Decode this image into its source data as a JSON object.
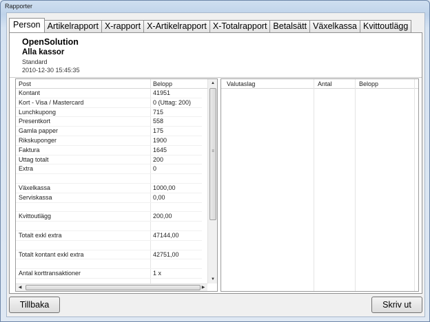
{
  "window": {
    "title": "Rapporter"
  },
  "tabs": [
    {
      "label": "Person",
      "active": true
    },
    {
      "label": "Artikelrapport"
    },
    {
      "label": "X-rapport"
    },
    {
      "label": "X-Artikelrapport"
    },
    {
      "label": "X-Totalrapport"
    },
    {
      "label": "Betalsätt"
    },
    {
      "label": "Växelkassa"
    },
    {
      "label": "Kvittoutlägg"
    }
  ],
  "header": {
    "company": "OpenSolution",
    "scope": "Alla kassor",
    "mode": "Standard",
    "datetime": "2010-12-30 15:45:35"
  },
  "left_table": {
    "columns": [
      "Post",
      "Belopp"
    ],
    "rows": [
      {
        "post": "Kontant",
        "belopp": "41951"
      },
      {
        "post": "Kort - Visa / Mastercard",
        "belopp": "0 (Uttag: 200)"
      },
      {
        "post": "Lunchkupong",
        "belopp": "715"
      },
      {
        "post": "Presentkort",
        "belopp": "558"
      },
      {
        "post": "Gamla papper",
        "belopp": "175"
      },
      {
        "post": "Rikskuponger",
        "belopp": "1900"
      },
      {
        "post": "Faktura",
        "belopp": "1645"
      },
      {
        "post": "Uttag totalt",
        "belopp": "200"
      },
      {
        "post": "Extra",
        "belopp": "0"
      },
      {
        "post": "",
        "belopp": ""
      },
      {
        "post": "Växelkassa",
        "belopp": "1000,00"
      },
      {
        "post": "Serviskassa",
        "belopp": "0,00"
      },
      {
        "post": "",
        "belopp": ""
      },
      {
        "post": "Kvittoutlägg",
        "belopp": "200,00"
      },
      {
        "post": "",
        "belopp": ""
      },
      {
        "post": "Totalt exkl extra",
        "belopp": "47144,00"
      },
      {
        "post": "",
        "belopp": ""
      },
      {
        "post": "Totalt kontant exkl extra",
        "belopp": "42751,00"
      },
      {
        "post": "",
        "belopp": ""
      },
      {
        "post": "Antal korttransaktioner",
        "belopp": "1 x"
      }
    ]
  },
  "right_table": {
    "columns": [
      "Valutaslag",
      "Antal",
      "Belopp"
    ]
  },
  "buttons": {
    "back": "Tillbaka",
    "print": "Skriv ut"
  }
}
